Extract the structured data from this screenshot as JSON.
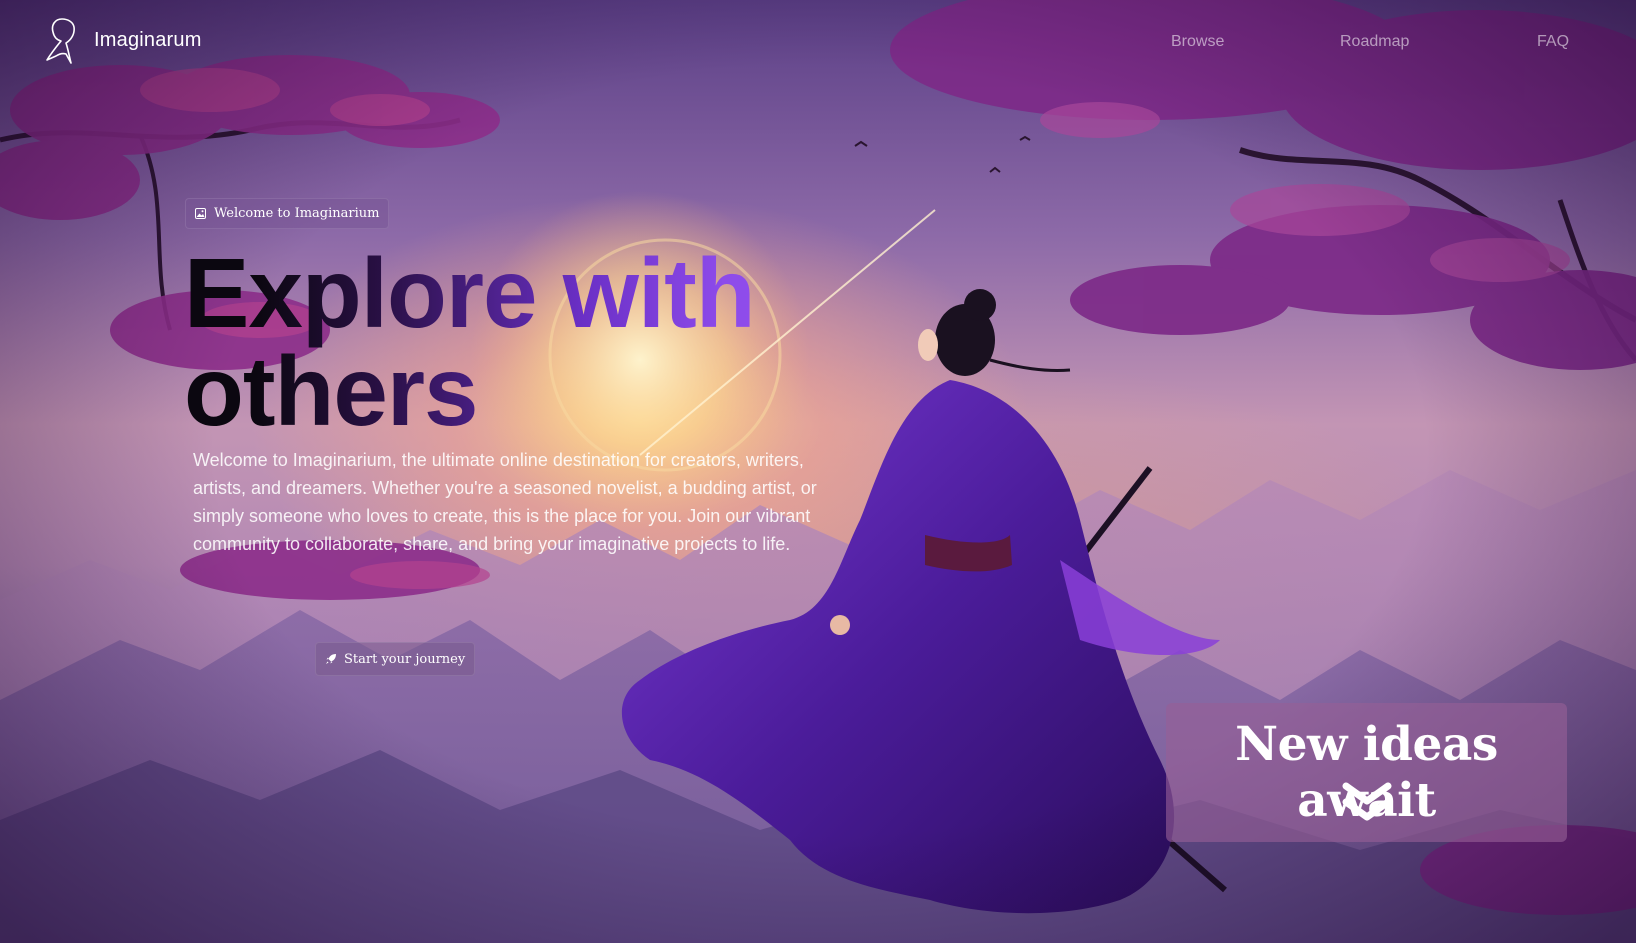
{
  "app": {
    "brand_name": "Imaginarum",
    "logo_icon": "person-silhouette-icon"
  },
  "nav": {
    "items": [
      {
        "label": "Browse"
      },
      {
        "label": "Roadmap"
      },
      {
        "label": "FAQ"
      }
    ]
  },
  "hero": {
    "badge_label": "Welcome to Imaginarium",
    "badge_icon": "image-icon",
    "headline_line1": "Explore with",
    "headline_line2": "others",
    "intro": "Welcome to Imaginarium, the ultimate online destination for creators, writers, artists, and dreamers. Whether you're a seasoned novelist, a budding artist, or simply someone who loves to create, this is the place for you. Join our vibrant community to collaborate, share, and bring your imaginative projects to life.",
    "cta_label": "Start your journey",
    "cta_icon": "rocket-icon"
  },
  "ideas_panel": {
    "title": "New ideas await",
    "icon": "double-chevron-down-icon"
  },
  "colors": {
    "headline_gradient_start": "#0b0710",
    "headline_gradient_end": "#9a55f0",
    "nav_text": "#ffffff8c",
    "panel_bg": "#965f96"
  }
}
